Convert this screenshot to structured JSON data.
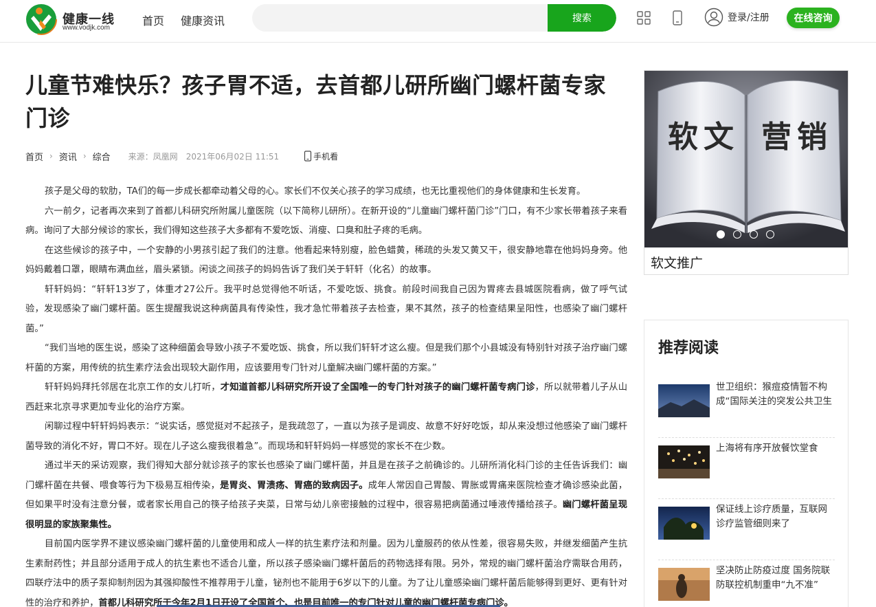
{
  "header": {
    "logo_title": "健康一线",
    "logo_url": "www.vodjk.com",
    "nav": [
      "首页",
      "健康资讯"
    ],
    "search_placeholder": "",
    "search_button": "搜索",
    "login_label": "登录/注册",
    "consult_button": "在线咨询"
  },
  "article": {
    "title": "儿童节难快乐？孩子胃不适，去首都儿研所幽门螺杆菌专家门诊",
    "breadcrumb": [
      "首页",
      "资讯",
      "综合"
    ],
    "source": "来源：凤凰网",
    "date": "2021年06月02日 11:51",
    "mobile_label": "手机看",
    "paragraphs": [
      {
        "parts": [
          "孩子是父母的软肋，TA们的每一步成长都牵动着父母的心。家长们不仅关心孩子的学习成绩，也无比重视他们的身体健康和生长发育。"
        ]
      },
      {
        "parts": [
          "六一前夕，记者再次来到了首都儿科研究所附属儿童医院（以下简称儿研所）。在新开设的“儿童幽门螺杆菌门诊”门口，有不少家长带着孩子来看病。询问了大部分候诊的家长，我们得知这些孩子大多都有不爱吃饭、消瘦、口臭和肚子疼的毛病。"
        ]
      },
      {
        "parts": [
          "在这些候诊的孩子中，一个安静的小男孩引起了我们的注意。他看起来特别瘦，脸色蜡黄，稀疏的头发又黄又干，很安静地靠在他妈妈身旁。他妈妈戴着口罩，眼睛布满血丝，眉头紧锁。闲谈之间孩子的妈妈告诉了我们关于轩轩（化名）的故事。"
        ]
      },
      {
        "parts": [
          "轩轩妈妈：“轩轩13岁了，体重才27公斤。我平时总觉得他不听话，不爱吃饭、挑食。前段时间我自己因为胃疼去县城医院看病，做了呼气试验，发现感染了幽门螺杆菌。医生提醒我说这种病菌具有传染性，我才急忙带着孩子去检查，果不其然，孩子的检查结果呈阳性，也感染了幽门螺杆菌。”"
        ]
      },
      {
        "parts": [
          "“我们当地的医生说，感染了这种细菌会导致小孩子不爱吃饭、挑食，所以我们轩轩才这么瘦。但是我们那个小县城没有特别针对孩子治疗幽门螺杆菌的方案，用传统的抗生素疗法会出现较大副作用，应该要用专门针对儿童解决幽门螺杆菌的方案。”"
        ]
      },
      {
        "parts": [
          "轩轩妈妈拜托邻居在北京工作的女儿打听，",
          "才知道首都儿科研究所开设了全国唯一的专门针对孩子的幽门螺杆菌专病门诊",
          "，所以就带着儿子从山西赶来北京寻求更加专业化的治疗方案。"
        ]
      },
      {
        "parts": [
          "闲聊过程中轩轩妈妈表示：“说实话，感觉挺对不起孩子，是我疏忽了，一直以为孩子是调皮、故意不好好吃饭，却从来没想过他感染了幽门螺杆菌导致的消化不好，胃口不好。现在儿子这么瘦我很着急”。而现场和轩轩妈妈一样感觉的家长不在少数。"
        ]
      },
      {
        "parts": [
          "通过半天的采访观察，我们得知大部分就诊孩子的家长也感染了幽门螺杆菌，并且是在孩子之前确诊的。儿研所消化科门诊的主任告诉我们：幽门螺杆菌在共餐、喂食等行为下极易互相传染，",
          "是胃炎、胃溃疡、胃癌的致病因子。",
          "成年人常因自己胃酸、胃胀或胃痛来医院检查才确诊感染此菌，但如果平时没有注意分餐，或者家长用自己的筷子给孩子夹菜，日常与幼儿亲密接触的过程中，很容易把病菌通过唾液传播给孩子。",
          "幽门螺杆菌呈现很明显的家族聚集性。"
        ]
      },
      {
        "parts": [
          "目前国内医学界不建议感染幽门螺杆菌的儿童使用和成人一样的抗生素疗法和剂量。因为儿童服药的依从性差，很容易失败，并继发细菌产生抗生素耐药性；并且部分适用于成人的抗生素也不适合儿童，所以孩子感染幽门螺杆菌后的药物选择有限。另外，常规的幽门螺杆菌治疗需联合用药，四联疗法中的质子泵抑制剂因为其强抑酸性不推荐用于儿童，铋剂也不能用于6岁以下的儿童。为了让儿童感染幽门螺杆菌后能够得到更好、更有针对性的治疗和养护，",
          "首都儿科研究所于今年2月1日开设了全国首个、也是目前唯一的专门针对儿童的幽门螺杆菌专病门诊。"
        ]
      }
    ]
  },
  "sidebar": {
    "banner_words": [
      "软文",
      "营销"
    ],
    "banner_caption": "软文推广",
    "carousel_active": 1,
    "carousel_count": 4,
    "rec_title": "推荐阅读",
    "rec_items": [
      {
        "title": "世卫组织：猴痘疫情暂不构成“国际关注的突发公共卫生事件”"
      },
      {
        "title": "上海将有序开放餐饮堂食"
      },
      {
        "title": "保证线上诊疗质量，互联网诊疗监管细则来了"
      },
      {
        "title": "坚决防止防疫过度 国务院联防联控机制重申“九不准”"
      }
    ]
  }
}
